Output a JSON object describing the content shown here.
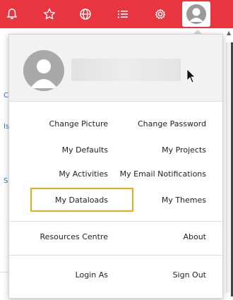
{
  "topbar": {
    "background_color": "#e8353f",
    "icons": [
      {
        "name": "notification-bell-icon"
      },
      {
        "name": "star-icon"
      },
      {
        "name": "globe-icon"
      },
      {
        "name": "list-icon"
      },
      {
        "name": "gear-icon"
      }
    ]
  },
  "profile": {
    "avatar_icon": "user-avatar-icon"
  },
  "menu": {
    "change_picture": "Change Picture",
    "change_password": "Change Password",
    "my_defaults": "My Defaults",
    "my_projects": "My Projects",
    "my_activities": "My Activities",
    "my_email_notifications": "My Email Notifications",
    "my_dataloads": "My Dataloads",
    "my_themes": "My Themes",
    "resources_centre": "Resources Centre",
    "about": "About",
    "login_as": "Login As",
    "sign_out": "Sign Out"
  },
  "highlight_color": "#f2a516",
  "background_fragments": {
    "frag1": "C",
    "frag2": "Is",
    "frag3": "S"
  }
}
